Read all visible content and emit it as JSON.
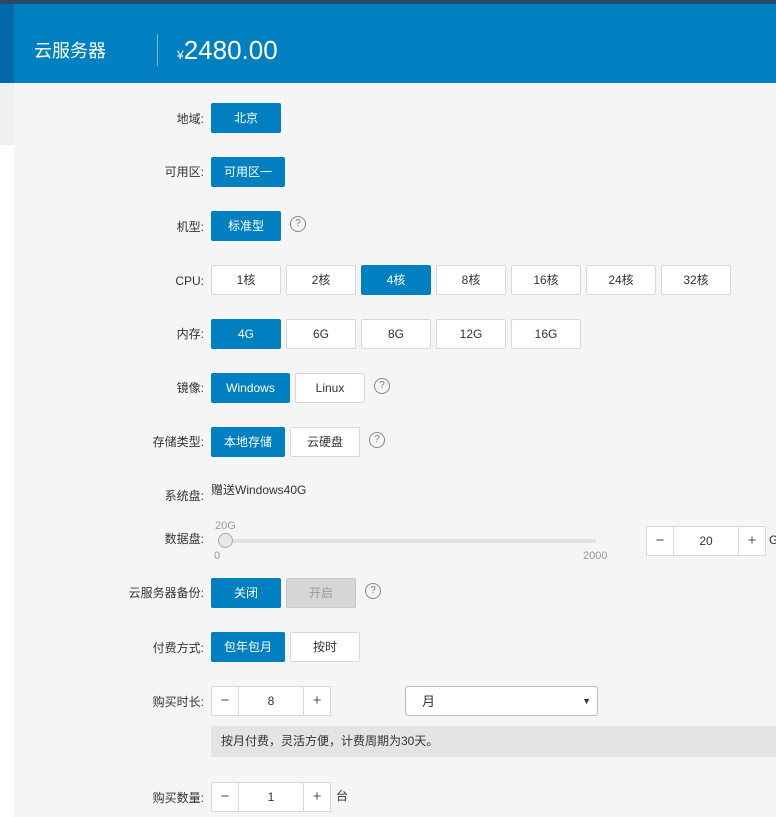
{
  "header": {
    "title": "云服务器",
    "currency": "¥",
    "price": "2480.00"
  },
  "region": {
    "label": "地域:",
    "options": [
      "北京"
    ],
    "selected": "北京"
  },
  "zone": {
    "label": "可用区:",
    "options": [
      "可用区一"
    ],
    "selected": "可用区一"
  },
  "type": {
    "label": "机型:",
    "options": [
      "标准型"
    ],
    "selected": "标准型",
    "help": "?"
  },
  "cpu": {
    "label": "CPU:",
    "options": [
      "1核",
      "2核",
      "4核",
      "8核",
      "16核",
      "24核",
      "32核"
    ],
    "selected": "4核"
  },
  "memory": {
    "label": "内存:",
    "options": [
      "4G",
      "6G",
      "8G",
      "12G",
      "16G"
    ],
    "selected": "4G"
  },
  "image": {
    "label": "镜像:",
    "options": [
      "Windows",
      "Linux"
    ],
    "selected": "Windows",
    "help": "?"
  },
  "storage": {
    "label": "存储类型:",
    "options": [
      "本地存储",
      "云硬盘"
    ],
    "selected": "本地存储",
    "help": "?"
  },
  "system_disk": {
    "label": "系统盘:",
    "value": "赠送Windows40G"
  },
  "data_disk": {
    "label": "数据盘:",
    "slider_value_label": "20G",
    "min_label": "0",
    "max_label": "2000",
    "value": "20",
    "minus": "−",
    "plus": "+",
    "unit": "G",
    "level": 20,
    "max": 2000
  },
  "backup": {
    "label": "云服务器备份:",
    "options": [
      "关闭",
      "开启"
    ],
    "selected": "关闭",
    "help": "?"
  },
  "billing": {
    "label": "付费方式:",
    "options": [
      "包年包月",
      "按时"
    ],
    "selected": "包年包月"
  },
  "duration": {
    "label": "购买时长:",
    "value": "8",
    "minus": "−",
    "plus": "+",
    "unit_selected": "月",
    "arrow": "▼"
  },
  "notice": "按月付费，灵活方便，计费周期为30天。",
  "quantity": {
    "label": "购买数量:",
    "value": "1",
    "minus": "−",
    "plus": "+",
    "unit": "台"
  }
}
